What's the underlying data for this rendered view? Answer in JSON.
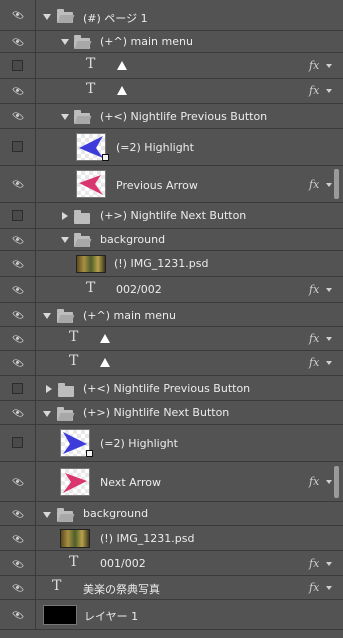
{
  "layers": {
    "page1_group": "(#) ページ 1",
    "main_menu_1": "(+^) main menu",
    "prev_group_1": "(+<) Nightlife Previous Button",
    "highlight_1": "(=2) Highlight",
    "previous_arrow": "Previous Arrow",
    "next_group_1": "(+>) Nightlife Next Button",
    "background_1": "background",
    "img_1": "(!) IMG_1231.psd",
    "counter_1": "002/002",
    "main_menu_2": "(+^) main menu",
    "prev_group_2": "(+<) Nightlife Previous Button",
    "next_group_2": "(+>) Nightlife Next Button",
    "highlight_2": "(=2) Highlight",
    "next_arrow": "Next Arrow",
    "background_2": "background",
    "img_2": "(!) IMG_1231.psd",
    "counter_2": "001/002",
    "festival_text": "美楽の祭典写真",
    "layer1": "レイヤー 1"
  },
  "glyphs": {
    "text_layer": "T",
    "fx": "fx"
  },
  "colors": {
    "panel_bg": "#535353",
    "row_border": "#3a3a3a",
    "arrow_blue": "#3d3bd9",
    "arrow_pink": "#d9356f"
  }
}
